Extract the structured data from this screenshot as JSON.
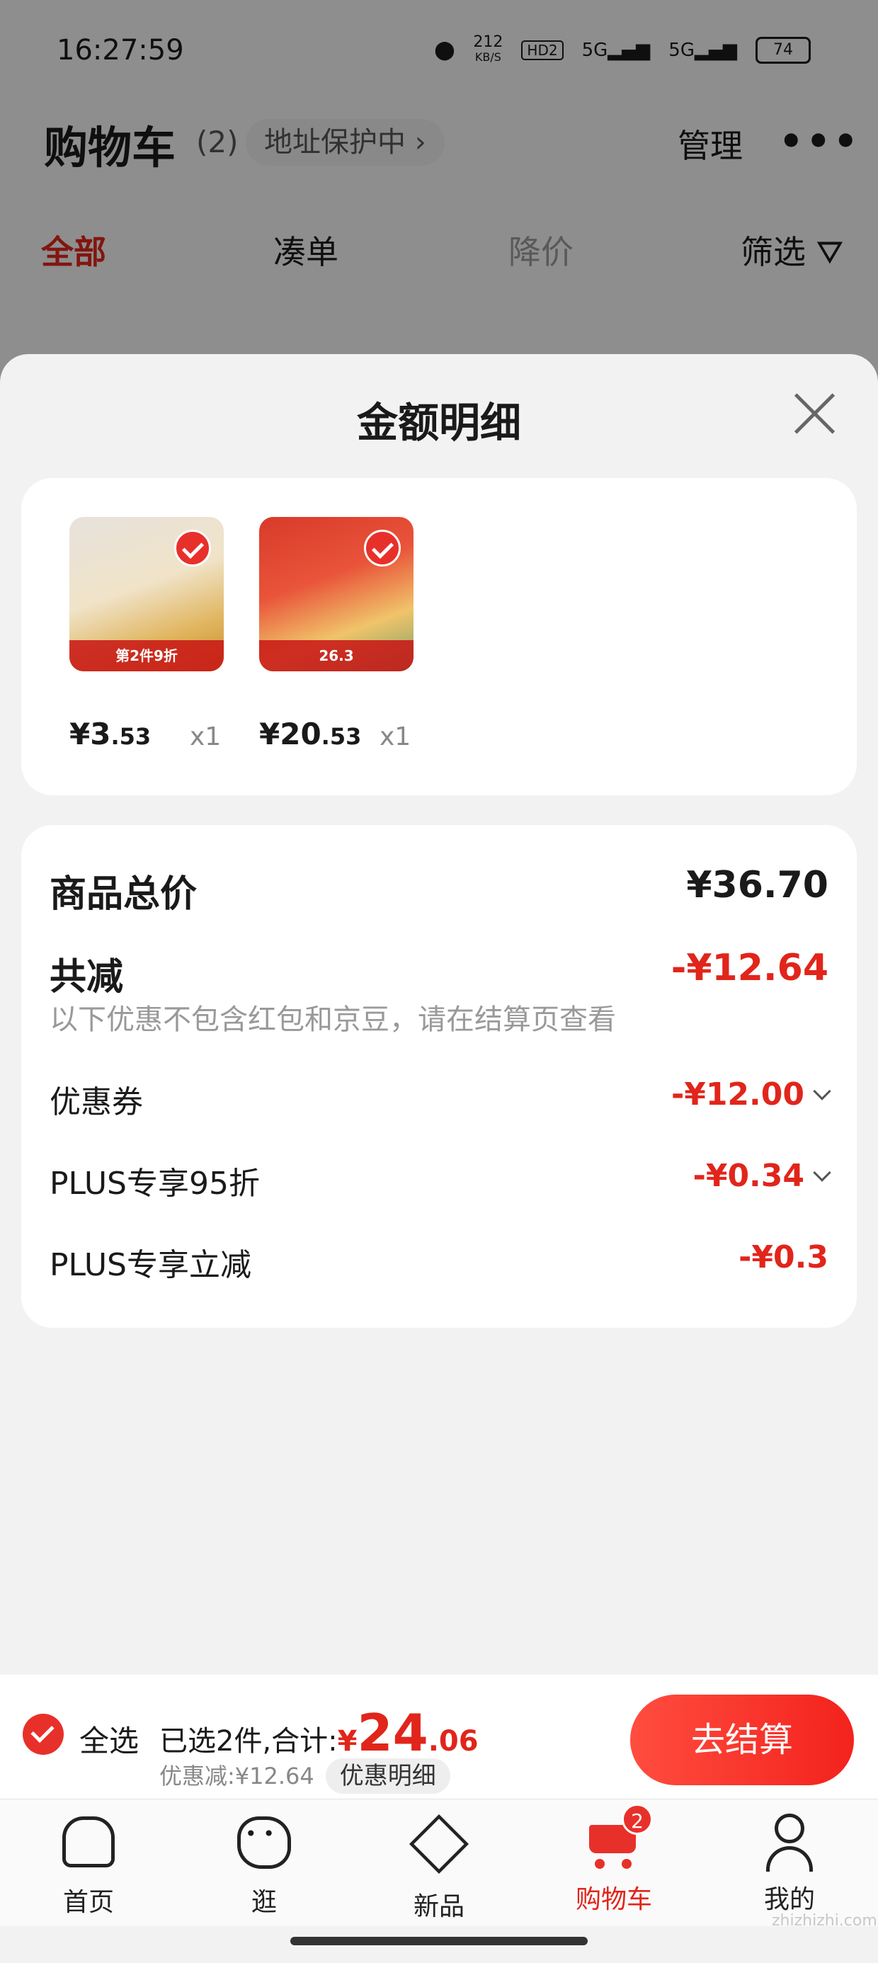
{
  "status_bar": {
    "time": "16:27:59",
    "net_speed": "212",
    "net_unit": "KB/S",
    "hd": "HD2",
    "sig1": "5G",
    "sig2": "5G",
    "battery": "74"
  },
  "header": {
    "title": "购物车",
    "count": "(2)",
    "address": "地址保护中 ›",
    "manage": "管理",
    "more": "•••"
  },
  "filters": [
    "全部",
    "凑单",
    "降价",
    "筛选"
  ],
  "sheet": {
    "title": "金额明细",
    "products": [
      {
        "price_int": "¥3",
        "price_dec": ".53",
        "qty": "x1",
        "badge": "第2件9折"
      },
      {
        "price_int": "¥20",
        "price_dec": ".53",
        "qty": "x1",
        "badge": "26.3"
      }
    ],
    "total_label": "商品总价",
    "total_value": "¥36.70",
    "reduce_label": "共减",
    "reduce_value": "-¥12.64",
    "reduce_note": "以下优惠不包含红包和京豆，请在结算页查看",
    "items": [
      {
        "label": "优惠券",
        "value": "-¥12.00"
      },
      {
        "label": "PLUS专享95折",
        "value": "-¥0.34"
      },
      {
        "label": "PLUS专享立减",
        "value": "-¥0.3"
      }
    ]
  },
  "checkout": {
    "select_all": "全选",
    "selected_text": "已选2件,合计:",
    "currency": "¥",
    "total_int": "24",
    "total_dec": ".06",
    "discount_text": "优惠减:¥12.64",
    "detail_button": "优惠明细",
    "checkout_button": "去结算"
  },
  "tabbar": {
    "tabs": [
      {
        "label": "首页"
      },
      {
        "label": "逛"
      },
      {
        "label": "新品"
      },
      {
        "label": "购物车",
        "badge": "2"
      },
      {
        "label": "我的"
      }
    ]
  },
  "watermark": "zhizhizhi.com",
  "colors": {
    "accent": "#e1251b",
    "background": "#f2f2f2",
    "card": "#ffffff"
  }
}
